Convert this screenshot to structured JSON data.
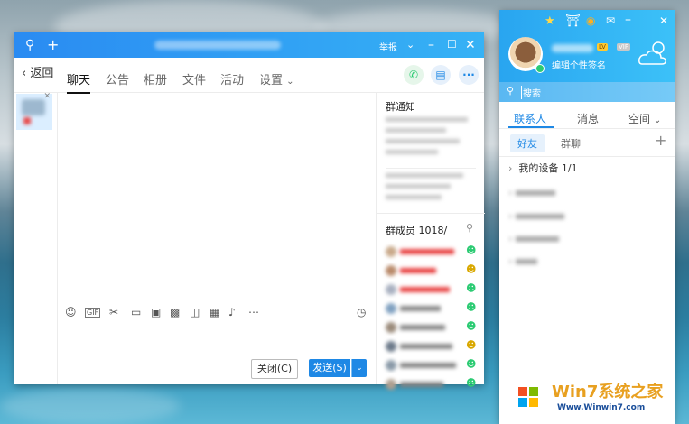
{
  "chat_window": {
    "title": "",
    "report_label": "举报",
    "back_label": "返回",
    "tabs": [
      {
        "label": "聊天"
      },
      {
        "label": "公告"
      },
      {
        "label": "相册"
      },
      {
        "label": "文件"
      },
      {
        "label": "活动"
      },
      {
        "label": "设置"
      }
    ],
    "notice_title": "群通知",
    "members_title": "群成员",
    "member_count": "1018/",
    "close_button": "关闭(C)",
    "send_button": "发送(S)"
  },
  "contacts_window": {
    "signature_placeholder": "编辑个性签名",
    "level_badge": "LV",
    "vip_badge": "VIP",
    "search_placeholder": "搜索",
    "tabs": [
      {
        "label": "联系人"
      },
      {
        "label": "消息"
      },
      {
        "label": "空间"
      }
    ],
    "subtabs": [
      {
        "label": "好友"
      },
      {
        "label": "群聊"
      }
    ],
    "groups": [
      {
        "label": "我的设备",
        "count": "1/1"
      }
    ]
  },
  "watermark": {
    "brand_text": "Win7系统之家",
    "url_text": "Www.Winwin7.com"
  },
  "colors": {
    "accent": "#2a8bf2",
    "contacts_accent": "#1e88e5",
    "member_name_red": "#e84343",
    "online_green": "#2ccb73"
  }
}
